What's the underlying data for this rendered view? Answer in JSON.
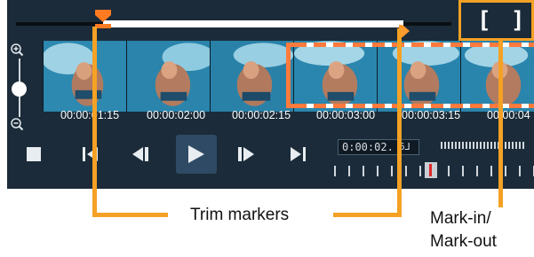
{
  "timeline": {
    "mark_in_label": "[",
    "mark_out_label": "]",
    "timecodes": [
      "00:00:01:15",
      "00:00:02:00",
      "00:00:02:15",
      "00:00:03:00",
      "00:00:03:15",
      "00:00:04"
    ],
    "current_timecode": "0:00:02.",
    "current_frame_icon": "6⅃"
  },
  "icons": {
    "zoom_in": "zoom-in-icon",
    "zoom_out": "zoom-out-icon",
    "stop": "stop-icon",
    "go_start": "skip-to-start-icon",
    "prev_frame": "previous-frame-icon",
    "play": "play-icon",
    "next_frame": "next-frame-icon",
    "go_end": "skip-to-end-icon"
  },
  "colors": {
    "accent_orange": "#f5a125",
    "selection": "#ff7a3c",
    "panel": "#1b2b39"
  },
  "callouts": {
    "trim": "Trim markers",
    "markio_line1": "Mark-in/",
    "markio_line2": "Mark-out"
  }
}
